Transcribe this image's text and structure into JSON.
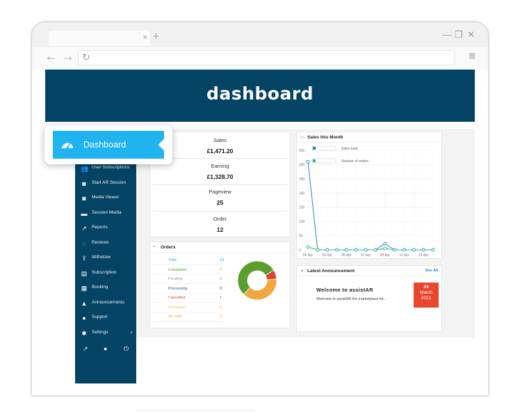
{
  "browser": {
    "tab_close": "×",
    "new_tab": "+",
    "minimize": "—",
    "restore": "❐",
    "close": "✕",
    "back": "←",
    "forward": "→",
    "reload": "↻",
    "menu": "≡"
  },
  "header": {
    "title": "dashboard"
  },
  "active_nav": {
    "label": "Dashboard",
    "icon": "speedometer-icon"
  },
  "sidebar": {
    "items": [
      {
        "label": "User Subscriptions",
        "icon": "users-icon",
        "glyph": "👥"
      },
      {
        "label": "Start AR Session",
        "icon": "camera-icon",
        "glyph": "◙"
      },
      {
        "label": "Media Viewer",
        "icon": "camera-icon",
        "glyph": "◙"
      },
      {
        "label": "Session Media",
        "icon": "folder-icon",
        "glyph": "▬"
      },
      {
        "label": "Reports",
        "icon": "line-chart-icon",
        "glyph": "↗"
      },
      {
        "label": "Reviews",
        "icon": "comment-icon",
        "glyph": "◌"
      },
      {
        "label": "Withdraw",
        "icon": "upload-icon",
        "glyph": "⇪"
      },
      {
        "label": "Subscription",
        "icon": "book-icon",
        "glyph": "▤"
      },
      {
        "label": "Booking",
        "icon": "calendar-icon",
        "glyph": "▦"
      },
      {
        "label": "Announcements",
        "icon": "bell-icon",
        "glyph": "▲"
      },
      {
        "label": "Support",
        "icon": "support-icon",
        "glyph": "●"
      },
      {
        "label": "Settings",
        "icon": "gear-icon",
        "glyph": "✱",
        "chevron": "›"
      }
    ],
    "bottom": {
      "external": "↗",
      "user": "●",
      "power": "⏻"
    }
  },
  "stats": [
    {
      "label": "Sales",
      "value": "£1,471.20"
    },
    {
      "label": "Earning",
      "value": "£1,328.70"
    },
    {
      "label": "Pageview",
      "value": "25"
    },
    {
      "label": "Order",
      "value": "12"
    }
  ],
  "orders": {
    "title": "Orders",
    "rows": [
      {
        "label": "Total",
        "value": "13",
        "color": "#2aa8d6"
      },
      {
        "label": "Completed",
        "value": "7",
        "color": "#5a9e2f"
      },
      {
        "label": "Pending",
        "value": "0",
        "color": "#9a9a9a"
      },
      {
        "label": "Processing",
        "value": "0",
        "color": "#1b5f8a"
      },
      {
        "label": "Cancelled",
        "value": "1",
        "color": "#d9452e"
      },
      {
        "label": "Refunded",
        "value": "0",
        "color": "#f2c45a"
      },
      {
        "label": "On hold",
        "value": "5",
        "color": "#f0a73f"
      }
    ]
  },
  "sales_chart": {
    "title": "Sales this Month",
    "legend": [
      {
        "label": "Sales total",
        "color": "#2f7fc1"
      },
      {
        "label": "Number of orders",
        "color": "#27b399"
      }
    ]
  },
  "chart_data": {
    "type": "line",
    "x": [
      "01 Apr",
      "02 Apr",
      "03 Apr",
      "04 Apr",
      "05 Apr",
      "06 Apr",
      "07 Apr",
      "08 Apr",
      "09 Apr",
      "10 Apr",
      "11 Apr",
      "12 Apr",
      "13 Apr",
      "14 Apr"
    ],
    "x_tick_labels": [
      "01 Apr",
      "03 Apr",
      "05 Apr",
      "07 Apr",
      "09 Apr",
      "11 Apr",
      "13 Apr"
    ],
    "series": [
      {
        "name": "Sales total",
        "values": [
          310,
          0,
          0,
          0,
          0,
          0,
          0,
          0,
          22,
          0,
          0,
          0,
          0,
          0
        ],
        "color": "#2f7fc1"
      },
      {
        "name": "Number of orders",
        "values": [
          2,
          0,
          0,
          0,
          0,
          0,
          0,
          0,
          1,
          0,
          0,
          0,
          0,
          0
        ],
        "color": "#27b399"
      }
    ],
    "y_ticks": [
      "0",
      "50",
      "100",
      "150",
      "200",
      "250",
      "300",
      "350"
    ],
    "ylim": [
      0,
      350
    ]
  },
  "announcement": {
    "title": "Latest Announcement",
    "see_all": "See All",
    "item_title": "Welcome to assistAR",
    "item_text": "Welcome to assistAR the marketplace for...",
    "day": "24",
    "month": "March",
    "year": "2021"
  },
  "colors": {
    "navy": "#044363",
    "accent": "#1fb3ef",
    "donut_completed": "#5a9e2f",
    "donut_onhold": "#f0a73f",
    "donut_cancelled": "#d9452e"
  }
}
